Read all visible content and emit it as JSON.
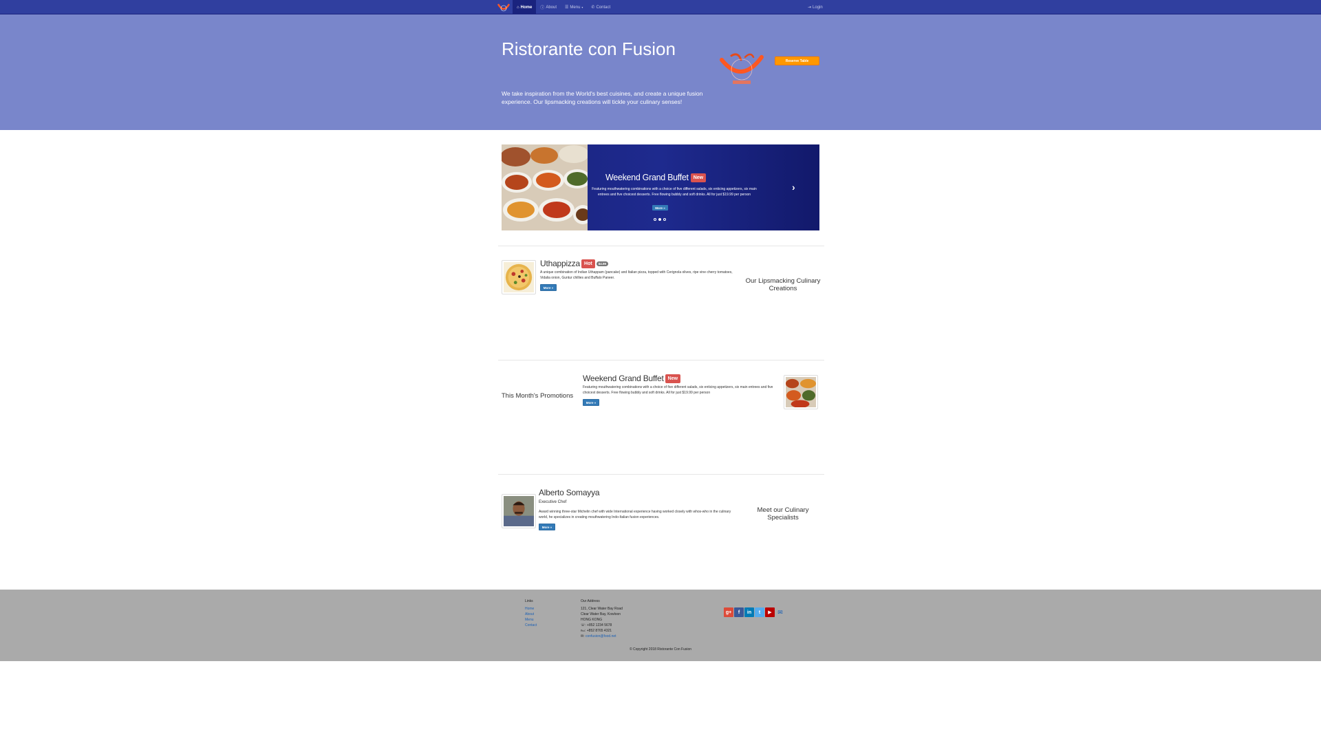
{
  "nav": {
    "items": [
      {
        "icon": "⌂",
        "label": "Home",
        "active": true
      },
      {
        "icon": "ⓘ",
        "label": "About"
      },
      {
        "icon": "☰",
        "label": "Menu"
      },
      {
        "icon": "✆",
        "label": "Contact"
      }
    ],
    "login_icon": "⇥",
    "login_label": "Login"
  },
  "jumbotron": {
    "title": "Ristorante con Fusion",
    "text": "We take inspiration from the World's best cuisines, and create a unique fusion experience. Our lipsmacking creations will tickle your culinary senses!",
    "reserve_label": "Reserve Table"
  },
  "carousel": {
    "title": "Weekend Grand Buffet",
    "badge": "New",
    "description": "Featuring mouthwatering combinations with a choice of five different salads, six enticing appetizers, six main entrees and five choicest desserts. Free flowing bubbly and soft drinks. All for just $19.99 per person",
    "more_label": "More »",
    "active_slide": 1,
    "slide_count": 3
  },
  "dish": {
    "title": "Uthappizza",
    "badge": "Hot",
    "price": "$4.99",
    "description": "A unique combination of Indian Uthappam (pancake) and Italian pizza, topped with Cerignola olives, ripe vine cherry tomatoes, Vidalia onion, Guntur chillies and Buffalo Paneer.",
    "more_label": "More »",
    "side_heading": "Our Lipsmacking Culinary Creations"
  },
  "promotion": {
    "title": "Weekend Grand Buffet",
    "badge": "New",
    "description": "Featuring mouthwatering combinations with a choice of five different salads, six enticing appetizers, six main entrees and five choicest desserts. Free flowing bubbly and soft drinks. All for just $19.99 per person",
    "more_label": "More »",
    "side_heading": "This Month's Promotions"
  },
  "leader": {
    "name": "Alberto Somayya",
    "designation": "Executive Chef",
    "description": "Award winning three-star Michelin chef with wide International experience having worked closely with whos-who in the culinary world, he specializes in creating mouthwatering Indo-Italian fusion experiences.",
    "more_label": "More »",
    "side_heading": "Meet our Culinary Specialists"
  },
  "footer": {
    "links_heading": "Links",
    "links": [
      "Home",
      "About",
      "Menu",
      "Contact"
    ],
    "address_heading": "Our Address",
    "address_lines": [
      "121, Clear Water Bay Road",
      "Clear Water Bay, Kowloon",
      "HONG KONG"
    ],
    "phone": "☏: +852 1234 5678",
    "fax": "℻: +852 8765 4321",
    "email_prefix": "✉: ",
    "email": "confusion@food.net",
    "social": [
      {
        "name": "google-plus",
        "label": "g+",
        "color": "#dd4b39"
      },
      {
        "name": "facebook",
        "label": "f",
        "color": "#3b5998"
      },
      {
        "name": "linkedin",
        "label": "in",
        "color": "#007bb6"
      },
      {
        "name": "twitter",
        "label": "t",
        "color": "#55acee"
      },
      {
        "name": "youtube",
        "label": "▶",
        "color": "#bb0000"
      }
    ],
    "mail_icon": "✉",
    "copyright": "© Copyright 2018 Ristorante Con Fusion"
  },
  "colors": {
    "navbar": "#303f9f",
    "jumbotron": "#7986cb",
    "reserve": "#ff9800",
    "footer": "#aaaaaa",
    "primary_btn": "#337ab7",
    "badge_danger": "#d9534f"
  }
}
